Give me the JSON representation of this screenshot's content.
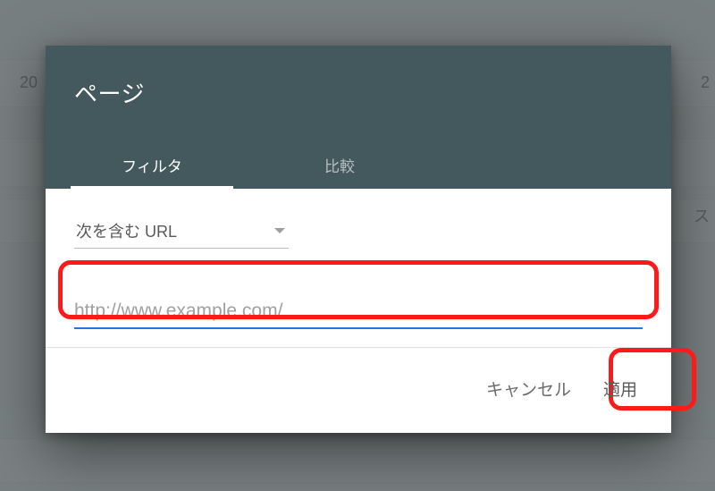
{
  "background": {
    "left_text": "20",
    "right_text": "2",
    "right_glyph": "ス"
  },
  "dialog": {
    "title": "ページ",
    "tabs": [
      {
        "label": "フィルタ",
        "active": true
      },
      {
        "label": "比較",
        "active": false
      }
    ],
    "filter": {
      "select_label": "次を含む URL",
      "url_placeholder": "http://www.example.com/",
      "url_value": ""
    },
    "actions": {
      "cancel": "キャンセル",
      "apply": "適用"
    }
  }
}
